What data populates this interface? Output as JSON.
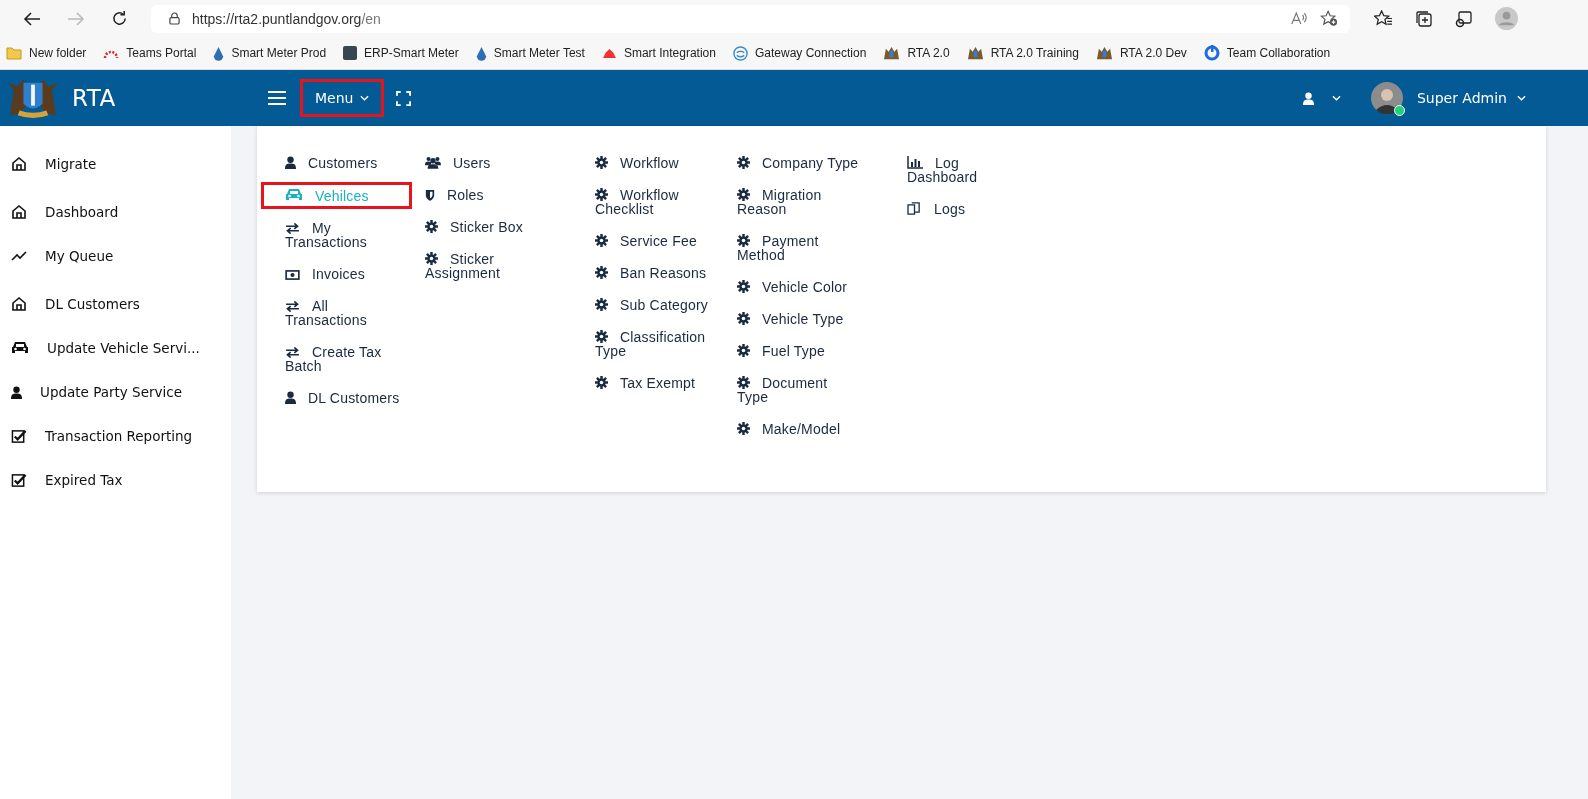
{
  "browser": {
    "url_host": "https://rta2.puntlandgov.org",
    "url_path": "/en",
    "bookmarks": [
      "New folder",
      "Teams Portal",
      "Smart Meter Prod",
      "ERP-Smart Meter",
      "Smart Meter Test",
      "Smart Integration",
      "Gateway Connection",
      "RTA 2.0",
      "RTA 2.0 Training",
      "RTA 2.0 Dev",
      "Team Collaboration"
    ]
  },
  "header": {
    "brand": "RTA",
    "menu_label": "Menu",
    "menu_highlighted": true,
    "user_name": "Super Admin",
    "online": true
  },
  "sidebar": {
    "groups": [
      [
        {
          "label": "Migrate"
        }
      ],
      [
        {
          "label": "Dashboard"
        },
        {
          "label": "My Queue"
        }
      ],
      [
        {
          "label": "DL Customers"
        },
        {
          "label": "Update Vehicle Servi..."
        },
        {
          "label": "Update Party Service"
        },
        {
          "label": "Transaction Reporting"
        },
        {
          "label": "Expired Tax"
        }
      ]
    ]
  },
  "mega_menu": {
    "columns": [
      [
        {
          "label": "Customers",
          "selected": false,
          "highlighted": false
        },
        {
          "label": "Vehilces",
          "selected": true,
          "highlighted": true
        },
        {
          "label": "My Transactions",
          "selected": false,
          "highlighted": false
        },
        {
          "label": "Invoices",
          "selected": false,
          "highlighted": false
        },
        {
          "label": "All Transactions",
          "selected": false,
          "highlighted": false
        },
        {
          "label": "Create Tax Batch",
          "selected": false,
          "highlighted": false
        },
        {
          "label": "DL Customers",
          "selected": false,
          "highlighted": false
        }
      ],
      [
        {
          "label": "Users",
          "selected": false,
          "highlighted": false
        },
        {
          "label": "Roles",
          "selected": false,
          "highlighted": false
        },
        {
          "label": "Sticker Box",
          "selected": false,
          "highlighted": false
        },
        {
          "label": "Sticker Assignment",
          "selected": false,
          "highlighted": false
        }
      ],
      [
        {
          "label": "Workflow",
          "selected": false,
          "highlighted": false
        },
        {
          "label": "Workflow Checklist",
          "selected": false,
          "highlighted": false
        },
        {
          "label": "Service Fee",
          "selected": false,
          "highlighted": false
        },
        {
          "label": "Ban Reasons",
          "selected": false,
          "highlighted": false
        },
        {
          "label": "Sub Category",
          "selected": false,
          "highlighted": false
        },
        {
          "label": "Classification Type",
          "selected": false,
          "highlighted": false
        },
        {
          "label": "Tax Exempt",
          "selected": false,
          "highlighted": false
        }
      ],
      [
        {
          "label": "Company Type",
          "selected": false,
          "highlighted": false
        },
        {
          "label": "Migration Reason",
          "selected": false,
          "highlighted": false
        },
        {
          "label": "Payment Method",
          "selected": false,
          "highlighted": false
        },
        {
          "label": "Vehicle Color",
          "selected": false,
          "highlighted": false
        },
        {
          "label": "Vehicle Type",
          "selected": false,
          "highlighted": false
        },
        {
          "label": "Fuel Type",
          "selected": false,
          "highlighted": false
        },
        {
          "label": "Document Type",
          "selected": false,
          "highlighted": false
        },
        {
          "label": "Make/Model",
          "selected": false,
          "highlighted": false
        }
      ],
      [
        {
          "label": "Log Dashboard",
          "selected": false,
          "highlighted": false
        },
        {
          "label": "Logs",
          "selected": false,
          "highlighted": false
        }
      ]
    ]
  }
}
